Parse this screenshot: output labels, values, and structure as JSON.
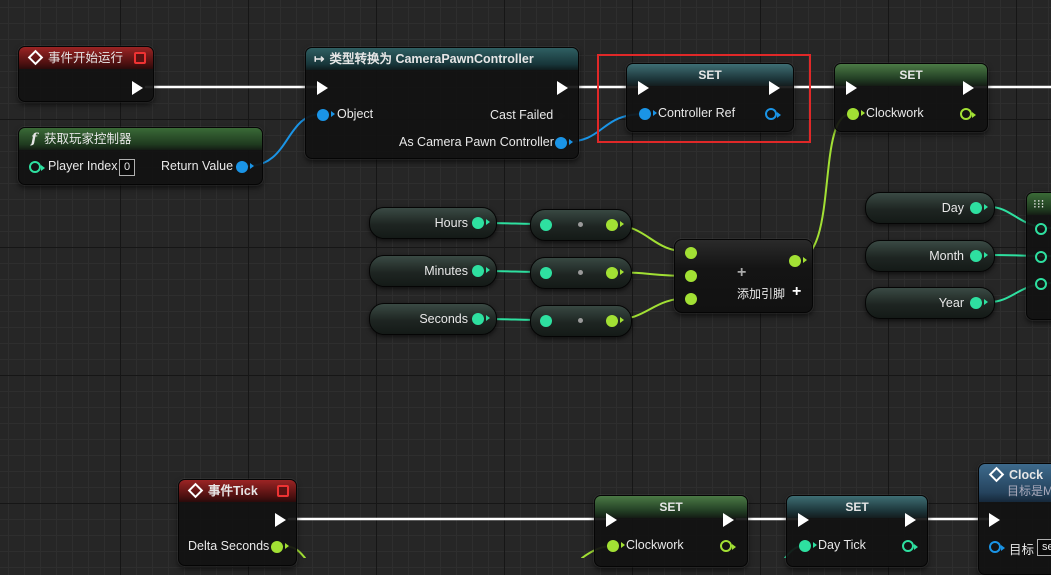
{
  "nodes": {
    "begin_play": {
      "title": "事件开始运行"
    },
    "get_player_controller": {
      "title": "获取玩家控制器",
      "player_index_label": "Player Index",
      "player_index_value": "0",
      "return_label": "Return Value"
    },
    "cast": {
      "title": "类型转换为 CameraPawnController",
      "object_label": "Object",
      "cast_failed_label": "Cast Failed",
      "as_label": "As Camera Pawn Controller"
    },
    "set_controller": {
      "title": "SET",
      "var_label": "Controller Ref"
    },
    "set_clockwork": {
      "title": "SET",
      "var_label": "Clockwork"
    },
    "hours": {
      "label": "Hours"
    },
    "minutes": {
      "label": "Minutes"
    },
    "seconds": {
      "label": "Seconds"
    },
    "day": {
      "label": "Day"
    },
    "month": {
      "label": "Month"
    },
    "year": {
      "label": "Year"
    },
    "make_array": {
      "add_pin_label": "添加引脚"
    },
    "event_tick": {
      "title": "事件Tick",
      "delta_label": "Delta Seconds"
    },
    "set_clockwork_2": {
      "title": "SET",
      "var_label": "Clockwork"
    },
    "set_day_tick": {
      "title": "SET",
      "var_label": "Day Tick"
    },
    "clock_node": {
      "title": "Clock",
      "subtitle": "目标是M",
      "target_label": "目标",
      "target_value": "se"
    }
  },
  "colors": {
    "exec": "#ffffff",
    "object_ref": "#1a94e6",
    "struct_green": "#a2e034",
    "int_teal": "#2ee0a0",
    "selection": "#e02828"
  }
}
